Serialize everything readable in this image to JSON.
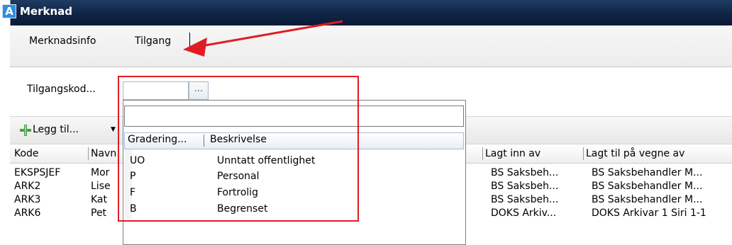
{
  "window": {
    "title": "Merknad",
    "app_icon_letter": "A"
  },
  "tabs": [
    {
      "label": "Merknadsinfo"
    },
    {
      "label": "Tilgang"
    }
  ],
  "form": {
    "access_code_label": "Tilgangskod...",
    "lookup_button_label": "..."
  },
  "toolbar": {
    "add_label": "Legg til...",
    "caret": "▼"
  },
  "grid": {
    "columns": [
      "Kode",
      "Navn",
      "Lagt inn av",
      "Lagt til på vegne av"
    ],
    "rows": [
      {
        "kode": "EKSPSJEF",
        "navn": "Mor",
        "lagt_inn_av": "BS Saksbeh...",
        "vegne_av": "BS Saksbehandler M..."
      },
      {
        "kode": "ARK2",
        "navn": "Lise",
        "lagt_inn_av": "BS Saksbeh...",
        "vegne_av": "BS Saksbehandler M..."
      },
      {
        "kode": "ARK3",
        "navn": "Kat",
        "lagt_inn_av": "BS Saksbeh...",
        "vegne_av": "BS Saksbehandler M..."
      },
      {
        "kode": "ARK6",
        "navn": "Pet",
        "lagt_inn_av": "DOKS Arkiv...",
        "vegne_av": "DOKS Arkivar 1 Siri 1-1"
      }
    ]
  },
  "dropdown": {
    "search_value": "",
    "columns": [
      "Gradering...",
      "Beskrivelse"
    ],
    "rows": [
      {
        "code": "UO",
        "description": "Unntatt offentlighet"
      },
      {
        "code": "P",
        "description": "Personal"
      },
      {
        "code": "F",
        "description": "Fortrolig"
      },
      {
        "code": "B",
        "description": "Begrenset"
      }
    ]
  },
  "colors": {
    "annotation": "#e01b24",
    "titlebar": "#0f2444"
  }
}
